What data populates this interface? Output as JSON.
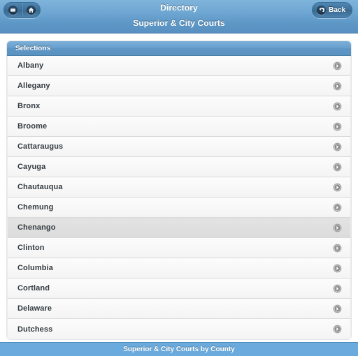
{
  "header": {
    "title": "Directory",
    "subtitle": "Superior & City Courts",
    "nav_buttons": [
      {
        "name": "list-button",
        "icon": "list-icon"
      },
      {
        "name": "home-button",
        "icon": "home-icon"
      }
    ],
    "back_button": {
      "label": "Back",
      "icon": "back-arrow-icon"
    }
  },
  "list": {
    "header_label": "Selections",
    "chevron_icon": "chevron-right-circle-icon",
    "rows": [
      {
        "label": "Albany",
        "active": false
      },
      {
        "label": "Allegany",
        "active": false
      },
      {
        "label": "Bronx",
        "active": false
      },
      {
        "label": "Broome",
        "active": false
      },
      {
        "label": "Cattaraugus",
        "active": false
      },
      {
        "label": "Cayuga",
        "active": false
      },
      {
        "label": "Chautauqua",
        "active": false
      },
      {
        "label": "Chemung",
        "active": false
      },
      {
        "label": "Chenango",
        "active": true
      },
      {
        "label": "Clinton",
        "active": false
      },
      {
        "label": "Columbia",
        "active": false
      },
      {
        "label": "Cortland",
        "active": false
      },
      {
        "label": "Delaware",
        "active": false
      },
      {
        "label": "Dutchess",
        "active": false
      }
    ]
  },
  "footer": {
    "text": "Superior & City Courts by County"
  },
  "colors": {
    "header_blue": "#6ea7d2",
    "footer_blue": "#6aaadc",
    "list_header_blue": "#679ecd",
    "row_text": "#333a40",
    "row_active_bg": "#dedede"
  }
}
